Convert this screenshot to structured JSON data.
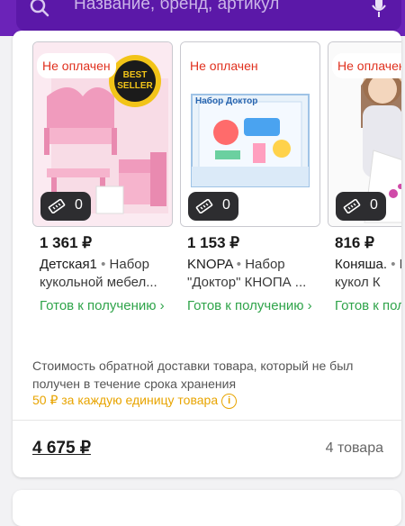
{
  "search": {
    "placeholder": "Название, бренд, артикул",
    "icon": "search-icon",
    "voice_icon": "microphone-icon"
  },
  "products": [
    {
      "badge": "Не оплачен",
      "size_count": "0",
      "price": "1 361 ₽",
      "brand": "Детская1",
      "sep": "•",
      "name": "Набор кукольной мебел...",
      "ready_label": "Готов к получению ›",
      "sticker": "BEST SELLER"
    },
    {
      "badge": "Не оплачен",
      "size_count": "0",
      "price": "1 153 ₽",
      "brand": "KNOPA",
      "sep": "•",
      "name": "Набор \"Доктор\" КНОПА ...",
      "ready_label": "Готов к получению ›",
      "box_label": "Набор Доктор"
    },
    {
      "badge": "Не оплачен",
      "size_count": "0",
      "price": "816 ₽",
      "brand": "Коняша.",
      "sep": "•",
      "name": "Н для кукол К",
      "ready_label": "Готов к получению ›"
    }
  ],
  "notice": "Стоимость обратной доставки товара, который не был получен в течение срока хранения",
  "fee": "50 ₽ за каждую единицу товара",
  "total": "4 675 ₽",
  "items_count": "4 товара",
  "colors": {
    "brand": "#6b23b8",
    "unpaid": "#e0301e",
    "ready": "#2fa44a",
    "fee": "#e8a400"
  }
}
